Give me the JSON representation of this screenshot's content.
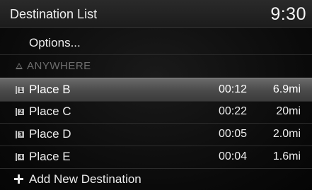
{
  "header": {
    "title": "Destination List",
    "clock": "9:30"
  },
  "menu": {
    "options_label": "Options...",
    "anywhere_label": "ANYWHERE",
    "add_label": "Add New Destination"
  },
  "destinations": [
    {
      "index": "1",
      "name": "Place B",
      "time": "00:12",
      "distance": "6.9mi",
      "selected": true
    },
    {
      "index": "2",
      "name": "Place C",
      "time": "00:22",
      "distance": "20mi",
      "selected": false
    },
    {
      "index": "3",
      "name": "Place D",
      "time": "00:05",
      "distance": "2.0mi",
      "selected": false
    },
    {
      "index": "4",
      "name": "Place E",
      "time": "00:04",
      "distance": "1.6mi",
      "selected": false
    }
  ],
  "icons": {
    "anywhere": "triangle-icon",
    "add": "plus-icon",
    "index_badge": "waypoint-number-icon"
  }
}
